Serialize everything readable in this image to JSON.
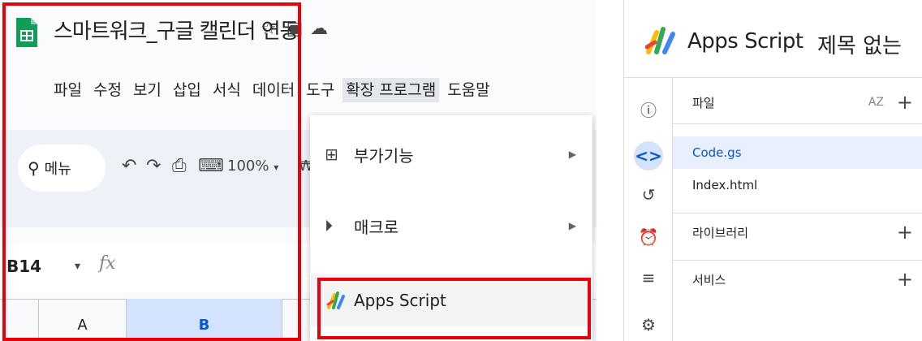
{
  "sheets": {
    "doc_title": "스마트워크_구글 캘린더 연동",
    "menu": [
      "파일",
      "수정",
      "보기",
      "삽입",
      "서식",
      "데이터",
      "도구",
      "확장 프로그램",
      "도움말"
    ],
    "search_label": "메뉴",
    "zoom": "100%",
    "currency": "₩",
    "name_box": "B14",
    "fx": "fx",
    "columns": [
      "A",
      "B"
    ],
    "extensions_menu": {
      "items": [
        {
          "label": "부가기능",
          "icon": "addon-icon"
        },
        {
          "label": "매크로",
          "icon": "macro-icon"
        },
        {
          "label": "Apps Script",
          "icon": "apps-script-icon"
        }
      ]
    }
  },
  "apps_script": {
    "app_name": "Apps Script",
    "project_title": "제목 없는",
    "files_header": "파일",
    "sort_label": "AZ",
    "files": [
      "Code.gs",
      "Index.html"
    ],
    "libraries_label": "라이브러리",
    "services_label": "서비스",
    "rail_icons": [
      "info-icon",
      "code-icon",
      "history-icon",
      "alarm-icon",
      "run-list-icon",
      "gear-icon"
    ]
  },
  "colors": {
    "highlight_red": "#e8000b",
    "sheets_green": "#0f9d58",
    "selection_blue": "#d3e3fd"
  }
}
